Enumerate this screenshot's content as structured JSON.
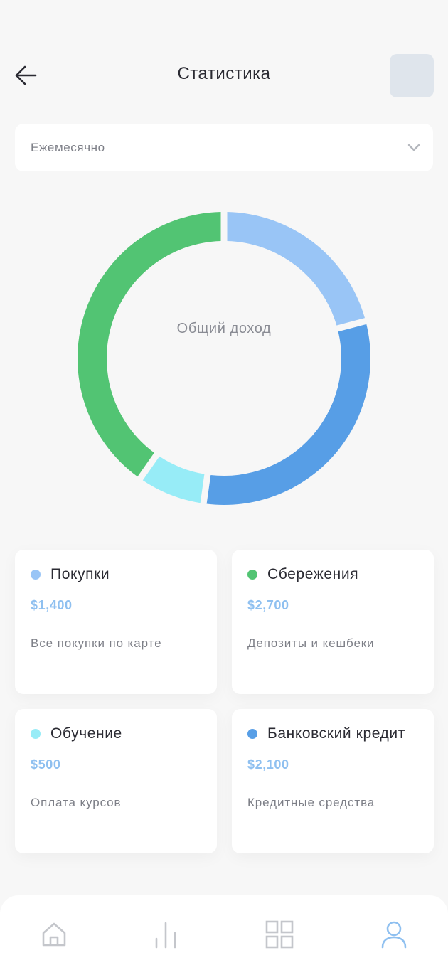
{
  "header": {
    "title": "Статистика"
  },
  "period_select": {
    "value": "Ежемесячно"
  },
  "chart_data": {
    "type": "pie",
    "center_label": "Общий доход",
    "categories": [
      "Покупки",
      "Банковский кредит",
      "Обучение",
      "Сбережения"
    ],
    "values": [
      1400,
      2100,
      500,
      2700
    ],
    "colors": [
      "#99c5f6",
      "#579ee6",
      "#97ecf7",
      "#52c473"
    ]
  },
  "cards": [
    {
      "title": "Покупки",
      "amount": "$1,400",
      "description": "Все покупки по карте",
      "color": "#99c5f6"
    },
    {
      "title": "Сбережения",
      "amount": "$2,700",
      "description": "Депозиты и кешбеки",
      "color": "#52c473"
    },
    {
      "title": "Обучение",
      "amount": "$500",
      "description": "Оплата курсов",
      "color": "#97ecf7"
    },
    {
      "title": "Банковский кредит",
      "amount": "$2,100",
      "description": "Кредитные средства",
      "color": "#579ee6"
    }
  ],
  "bottom_nav": {
    "items": [
      {
        "icon": "home-icon",
        "active": false
      },
      {
        "icon": "stats-icon",
        "active": false
      },
      {
        "icon": "grid-icon",
        "active": false
      },
      {
        "icon": "profile-icon",
        "active": true
      }
    ],
    "active_color": "#8fc0f0",
    "inactive_color": "#c4c6cb"
  }
}
